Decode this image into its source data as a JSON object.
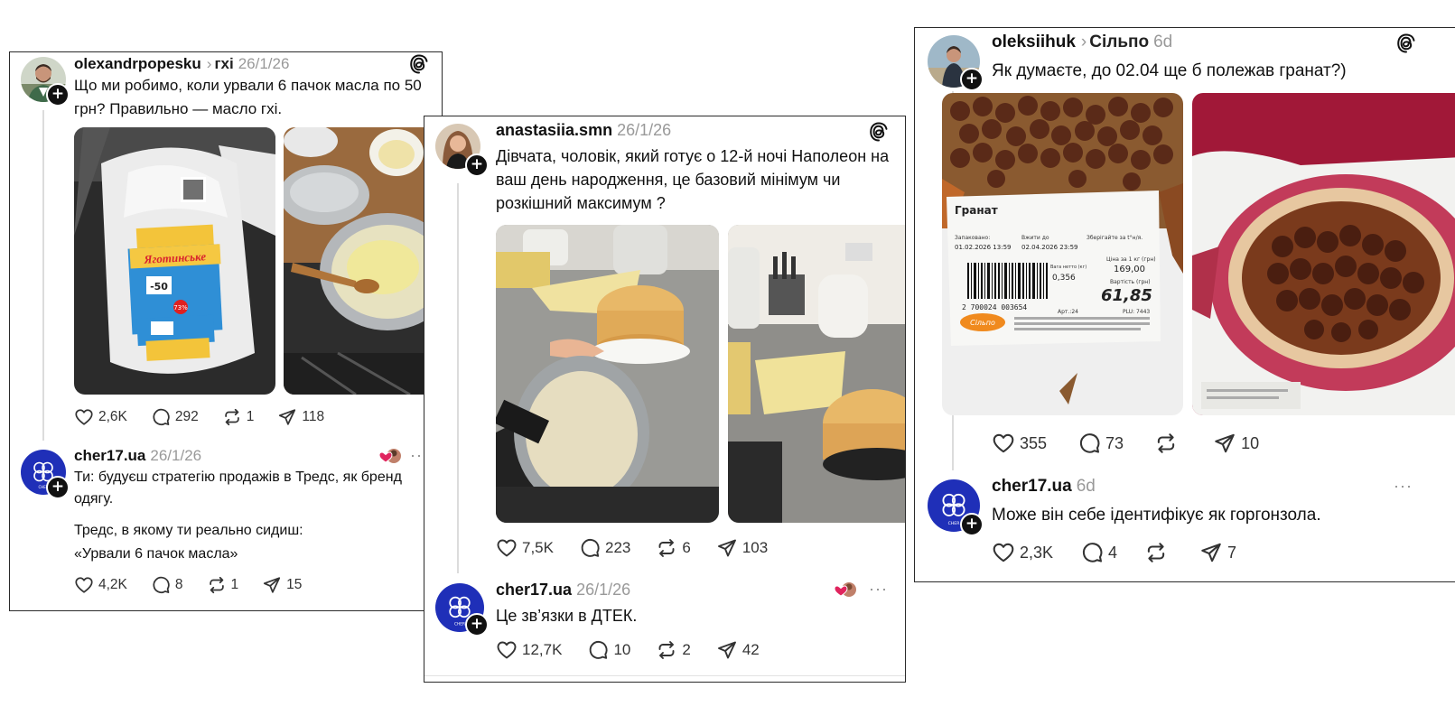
{
  "posts": [
    {
      "user": "olexandrpopesku",
      "topic": "гхі",
      "time": "26/1/26",
      "text": "Що ми робимо, коли урвали 6 пачок масла по 50 грн? Правильно — масло гхі.",
      "stats": {
        "likes": "2,6K",
        "comments": "292",
        "reposts": "1",
        "shares": "118"
      },
      "image1": {
        "brand": "Яготинське",
        "price_tag": "-50",
        "percent": "73%"
      },
      "reply": {
        "user": "cher17.ua",
        "time": "26/1/26",
        "text1": "Ти: будуєш стратегію продажів в Тредс, як бренд одягу.",
        "text2": "Тредс, в якому ти реально сидиш:",
        "text3": "«Урвали 6 пачок масла»",
        "stats": {
          "likes": "4,2K",
          "comments": "8",
          "reposts": "1",
          "shares": "15"
        }
      }
    },
    {
      "user": "anastasiia.smn",
      "time": "26/1/26",
      "text": "Дівчата, чоловік, який готує о 12-й ночі Наполеон на ваш день народження, це базовий мінімум чи розкішний максимум ?",
      "stats": {
        "likes": "7,5K",
        "comments": "223",
        "reposts": "6",
        "shares": "103"
      },
      "reply": {
        "user": "cher17.ua",
        "time": "26/1/26",
        "text1": "Це зв’язки в ДТЕК.",
        "stats": {
          "likes": "12,7K",
          "comments": "10",
          "reposts": "2",
          "shares": "42"
        }
      }
    },
    {
      "user": "oleksiihuk",
      "topic": "Сільпо",
      "time": "6d",
      "text": "Як думаєте, до 02.04 ще б полежав гранат?)",
      "stats": {
        "likes": "355",
        "comments": "73",
        "reposts": "",
        "shares": "10"
      },
      "label": {
        "title": "Гранат",
        "packed_label": "Запаковано:",
        "packed": "01.02.2026 13:59",
        "use_label": "Вжити до",
        "use_by": "02.04.2026 23:59",
        "store": "Зберігайте за t°н/я.",
        "price_per_kg_label": "Ціна за 1 кг (грн)",
        "price_per_kg": "169,00",
        "weight_label": "Вага нетто (кг)",
        "weight": "0,356",
        "cost_label": "Вартість (грн)",
        "cost": "61,85",
        "barcode": "2 700024 003654",
        "art": "Арт.:24",
        "plu": "PLU: 7443",
        "logo": "Сільпо"
      },
      "reply": {
        "user": "cher17.ua",
        "time": "6d",
        "text1": "Може він себе ідентифікує як горгонзола.",
        "stats": {
          "likes": "2,3K",
          "comments": "4",
          "reposts": "",
          "shares": "7"
        }
      }
    }
  ],
  "colors": {
    "accent_blue": "#1f2fb8",
    "like_red": "#e0245e",
    "muted": "#999999"
  },
  "icons": [
    "heart-icon",
    "comment-icon",
    "repost-icon",
    "share-icon",
    "threads-logo-icon",
    "more-icon",
    "plus-icon"
  ]
}
